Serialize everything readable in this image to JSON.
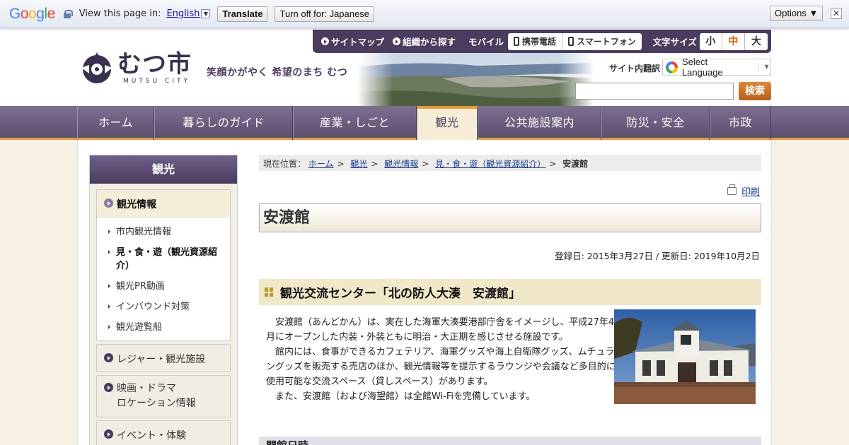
{
  "translate_bar": {
    "logo": [
      "G",
      "o",
      "o",
      "g",
      "l",
      "e"
    ],
    "view_text": "View this page in:",
    "language": "English",
    "translate_btn": "Translate",
    "turn_off_btn": "Turn off for: Japanese",
    "options_btn": "Options ▼",
    "close": "✕"
  },
  "header": {
    "site_name_jp": "むつ市",
    "site_name_en": "MUTSU CITY",
    "slogan": "笑顔かがやく 希望のまち むつ",
    "util": {
      "sitemap": "サイトマップ",
      "org_search": "組織から探す",
      "mobile_label": "モバイル",
      "keitai": "携帯電話",
      "smartphone": "スマートフォン",
      "fontsize_label": "文字サイズ",
      "fs_small": "小",
      "fs_medium": "中",
      "fs_large": "大"
    },
    "site_translate": "サイト内翻訳",
    "select_language": "Select Language",
    "search_btn": "検索",
    "search_value": ""
  },
  "nav": [
    "ホーム",
    "暮らしのガイド",
    "産業・しごと",
    "観光",
    "公共施設案内",
    "防災・安全",
    "市政"
  ],
  "sidebar": {
    "title": "観光",
    "open_section": "観光情報",
    "sub_items": [
      "市内観光情報",
      "見・食・遊（観光資源紹介）",
      "観光PR動画",
      "インバウンド対策",
      "観光遊覧船"
    ],
    "sections": [
      "レジャー・観光施設",
      "映画・ドラマ",
      "ロケーション情報",
      "イベント・体験"
    ]
  },
  "breadcrumb": {
    "label": "現在位置：",
    "items": [
      "ホーム",
      "観光",
      "観光情報",
      "見・食・遊（観光資源紹介）"
    ],
    "current": "安渡館"
  },
  "article": {
    "print": "印刷",
    "title": "安渡館",
    "dates": "登録日: 2015年3月27日 /  更新日: 2019年10月2日",
    "h2": "観光交流センター「北の防人大湊　安渡館」",
    "paragraphs": [
      "安渡館（あんどかん）は、実在した海軍大湊要港部庁舎をイメージし、平成27年4月にオープンした内装・外装ともに明治・大正期を感じさせる施設です。",
      "館内には、食事ができるカフェテリア、海軍グッズや海上自衛隊グッズ、ムチュラングッズを販売する売店のほか、観光情報等を提示するラウンジや会議など多目的に使用可能な交流スペース（貸しスペース）があります。",
      "また、安渡館（および海望館）は全館Wi-Fiを完備しています。"
    ],
    "h3": "開館日時"
  },
  "colors": {
    "purple": "#4a3c5e",
    "orange": "#e59a3c",
    "accent_red": "#e05a10"
  }
}
